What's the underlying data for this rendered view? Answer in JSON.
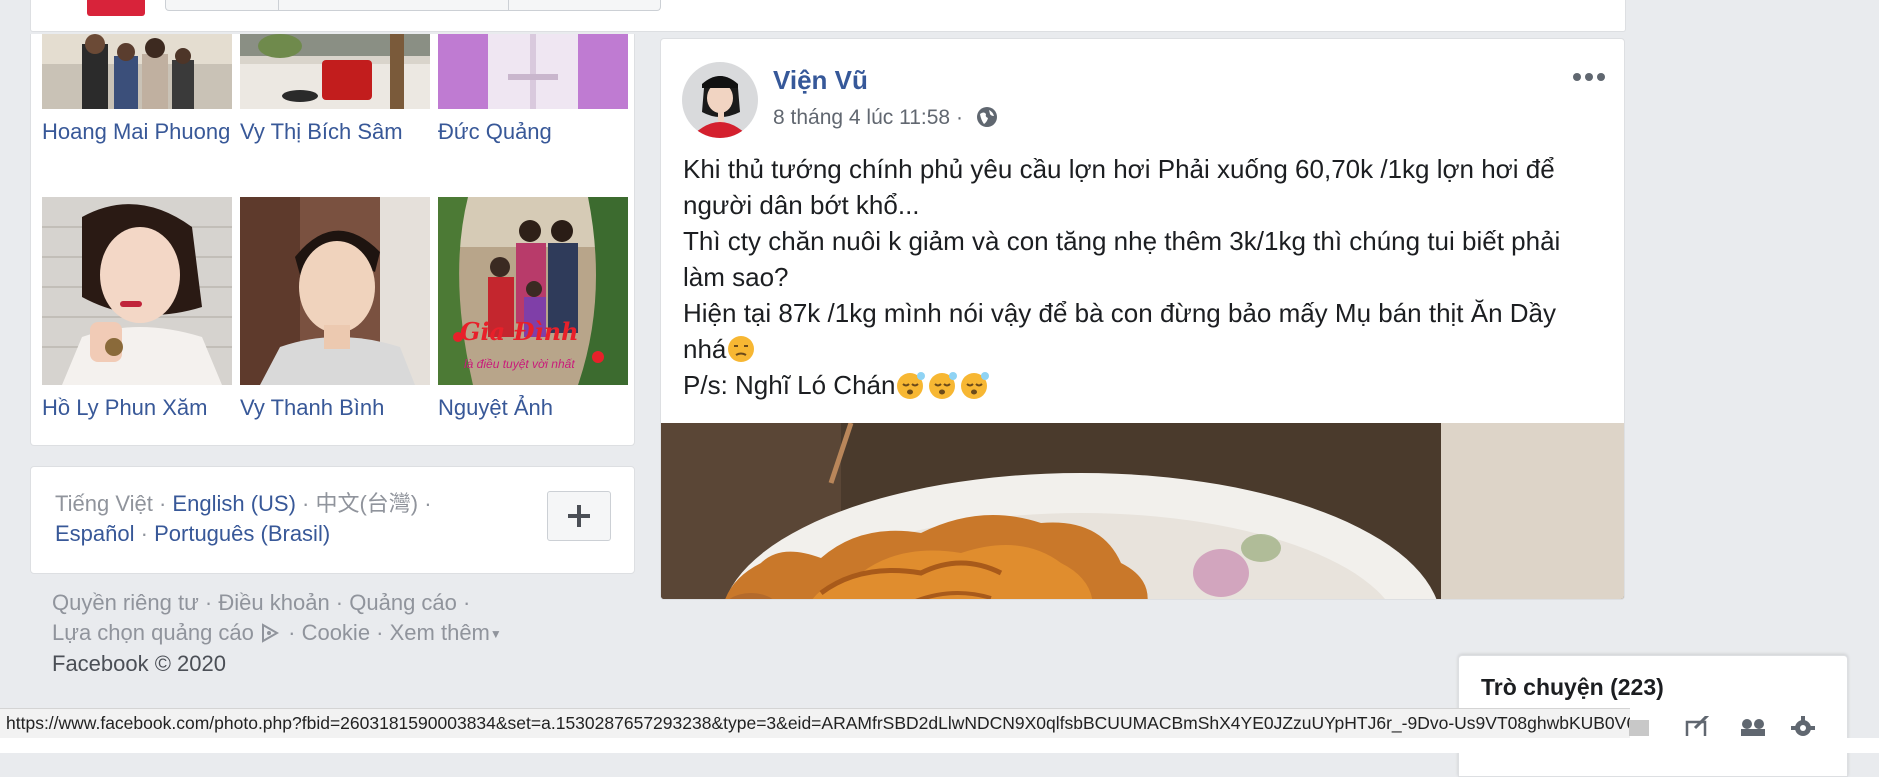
{
  "friends": [
    {
      "name": "Hoang Mai Phuong"
    },
    {
      "name": "Vy Thị Bích Sâm"
    },
    {
      "name": "Đức Quảng"
    },
    {
      "name": "Hồ Ly Phun Xăm"
    },
    {
      "name": "Vy Thanh Bình"
    },
    {
      "name": "Nguyệt Ảnh"
    }
  ],
  "languages": {
    "current": "Tiếng Việt",
    "sep": "·",
    "items": [
      "English (US)",
      "中文(台灣)",
      "Español",
      "Português (Brasil)"
    ]
  },
  "footer": {
    "links": [
      "Quyền riêng tư",
      "Điều khoản",
      "Quảng cáo",
      "Lựa chọn quảng cáo",
      "Cookie",
      "Xem thêm"
    ],
    "copyright": "Facebook © 2020"
  },
  "post": {
    "author": "Viện Vũ",
    "time": "8 tháng 4 lúc 11:58",
    "meta_sep": "·",
    "lines": [
      "Khi thủ tướng chính phủ yêu cầu lợn hơi Phải xuống 60,70k /1kg lợn hơi để người dân bớt khổ...",
      "Thì cty chăn nuôi k giảm và con tăng nhẹ thêm 3k/1kg thì chúng tui biết phải làm sao?",
      "Hiện tại 87k /1kg mình nói vậy để bà con đừng bảo mấy Mụ bán thịt Ăn Dầy nhá",
      "P/s: Nghĩ Ló Chán"
    ]
  },
  "friend_photo_caption": {
    "line1": "Gia Đình",
    "line2": "là điều tuyệt vời nhất"
  },
  "chat": {
    "title": "Trò chuyện (223)"
  },
  "status_url": "https://www.facebook.com/photo.php?fbid=2603181590003834&set=a.1530287657293238&type=3&eid=ARAMfrSBD2dLlwNDCN9X0qlfsbBCUUMACBmShX4YE0JZzuUYpHTJ6r_-9Dvo-Us9VT08ghwbKUB0V6hI",
  "colors": {
    "link": "#385898",
    "author": "#365899",
    "background": "#e9ebee"
  },
  "icons": [
    "globe-icon",
    "more-options-icon",
    "plus-icon",
    "ad-choices-icon",
    "caret-down-icon",
    "compose-icon",
    "group-icon",
    "gear-icon",
    "emoji-unamused",
    "emoji-sleepy"
  ]
}
